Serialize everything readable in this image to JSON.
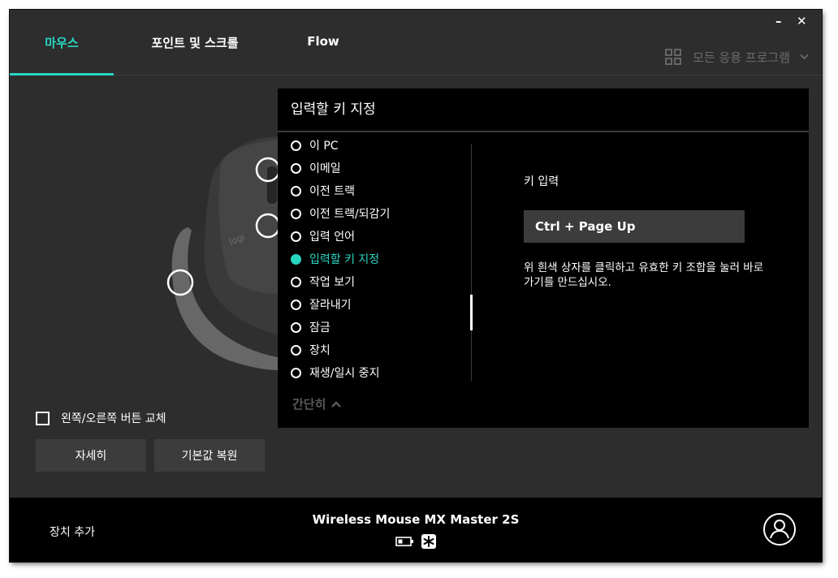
{
  "window": {
    "minimize": "–",
    "close": "✕"
  },
  "tabs": [
    {
      "label": "마우스",
      "active": true
    },
    {
      "label": "포인트 및 스크롤",
      "active": false
    },
    {
      "label": "Flow",
      "active": false
    }
  ],
  "apps_selector": {
    "label": "모든 응용 프로그램",
    "icon": "grid-icon",
    "chevron": "chevron-down-icon"
  },
  "mouse": {
    "swap_buttons_label": "왼쪽/오른쪽 버튼 교체",
    "swap_buttons_checked": false,
    "more_button": "자세히",
    "restore_defaults_button": "기본값 복원"
  },
  "panel": {
    "title": "입력할 키 지정",
    "actions": [
      "이 PC",
      "이메일",
      "이전 트랙",
      "이전 트랙/되감기",
      "입력 언어",
      "입력할 키 지정",
      "작업 보기",
      "잘라내기",
      "잠금",
      "장치",
      "재생/일시 중지"
    ],
    "selected_action": "입력할 키 지정",
    "collapse_label": "간단히",
    "key_label": "키 입력",
    "key_value": "Ctrl + Page Up",
    "help_text": "위 흰색 상자를 클릭하고 유효한 키 조합을 눌러 바로가기를 만드십시오."
  },
  "footer": {
    "add_device": "장치 추가",
    "device_name": "Wireless Mouse MX Master 2S",
    "status_icons": [
      "battery-icon",
      "unifying-receiver-icon"
    ],
    "account_icon": "account-icon"
  },
  "colors": {
    "accent": "#29d6c1",
    "background": "#2d2d2d",
    "panel": "#000000",
    "button": "#3c3c3c"
  }
}
